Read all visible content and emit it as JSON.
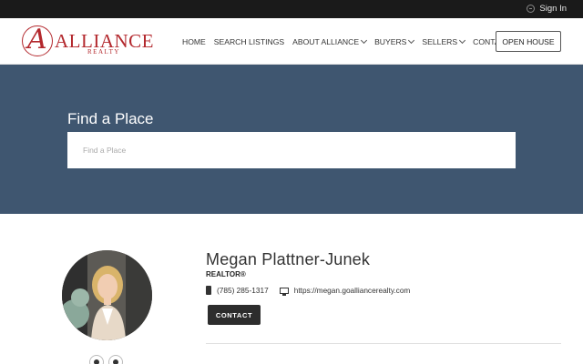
{
  "topbar": {
    "signin_label": "Sign In"
  },
  "brand": {
    "word": "ALLIANCE",
    "sub": "REALTY",
    "initial": "A",
    "color": "#b3282d"
  },
  "nav": {
    "items": [
      {
        "label": "HOME"
      },
      {
        "label": "SEARCH LISTINGS"
      },
      {
        "label": "ABOUT ALLIANCE"
      },
      {
        "label": "BUYERS"
      },
      {
        "label": "SELLERS"
      },
      {
        "label": "CONTACT"
      }
    ],
    "open_house_label": "OPEN HOUSE"
  },
  "hero": {
    "title": "Find a Place",
    "search_placeholder": "Find a Place",
    "background": "#3f5670"
  },
  "agent": {
    "name": "Megan Plattner-Junek",
    "role": "REALTOR®",
    "phone": "(785) 285-1317",
    "website": "https://megan.goalliancerealty.com",
    "contact_label": "CONTACT",
    "social": [
      "facebook-icon",
      "instagram-icon"
    ]
  }
}
